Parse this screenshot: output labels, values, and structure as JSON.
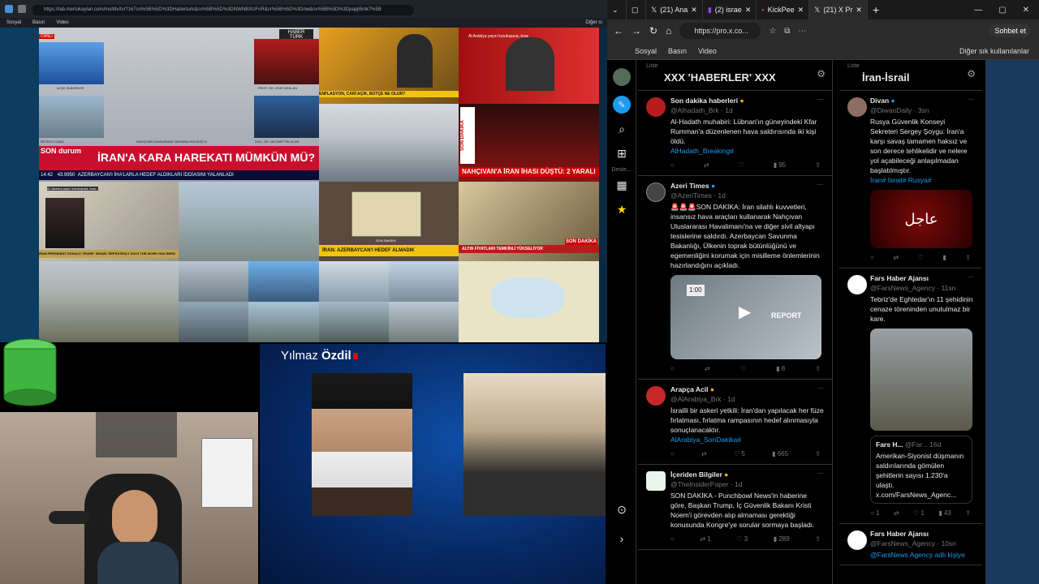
{
  "left_browser": {
    "url": "https://lab.mertokaylan.com/multitv/tv/?167cn%5B%5D%3DHaberturk&cv%5B%5D%3DNWNBSUFnR&cr%5B%5D%3Dnw&nv%5B%5D%3Dpapji5nlk7%5B",
    "bookmarks": [
      "Sosyal",
      "Basın",
      "Video"
    ],
    "other_bookmarks": "Diğer sı",
    "tiles": {
      "canli": "CANLI",
      "haber_logo": "HABER TÜRK",
      "anchor_name": "AYŞE SUBERKER",
      "guest1": "PROF. DR. ERAT ARSLAN",
      "guest2": "DOÇ. DR. NECMETTİN ACAR",
      "beyrut": "BEYRUT-CANLI",
      "nahcivan_small": "NAHÇIVAN HAVALİMANI YAKININA İHA DÜŞTÜ",
      "son_durum": "SON durum",
      "headline": "İRAN'A KARA HAREKATI MÜMKÜN MÜ?",
      "time": "14:42",
      "index": "43.9950",
      "sub": "AZERBAYCAN'I İHA'LARLA HEDEF ALDIKLARI İDDİASINI YALANLADI",
      "son_dakika_tag": "SON DAKİKA",
      "econ": "ENFLASYON, CARİ AÇIK, BÜTÇE NE OLUR?",
      "alarabiya_tag": "Al Arabiya yayın kuruluşuna, kısa",
      "son_dakika_vertical": "SON DAKİKA",
      "nahcivan_big": "NAHÇIVAN'A İRAN İHASI DÜŞTÜ: 2 YARALI",
      "aljazeera": "Al Jazeera yayın kuruluşuna, kısa...",
      "aljazeera_sub": "IRAN PRESIDENT DONALD TRUMP: ISRAEL REPEATEDLY SAYS THE WORK HAS BEEN",
      "iran_azer": "İRAN: AZERBAYCAN'I HEDEF ALMADIK",
      "son_dakika_small": "SON DAKİKA",
      "altin": "ALTIN FİYATLARI TEMKİNLİ YÜKSELİYOR",
      "son_dakika_red": "SON DAKİKA",
      "canli2": "CANLI"
    }
  },
  "video_panel": {
    "name_first": "Yılmaz",
    "name_last": "Özdil"
  },
  "right_browser": {
    "tabs": [
      {
        "label": "(21) Ana",
        "icon": "x-icon"
      },
      {
        "label": "(2) israe",
        "icon": "twitch-icon"
      },
      {
        "label": "KickPee",
        "icon": "kick-icon"
      },
      {
        "label": "(21) X Pr",
        "icon": "x-icon"
      }
    ],
    "url": "https://pro.x.co...",
    "chat_label": "Sohbet et",
    "bookmarks": [
      "Sosyal",
      "Basın",
      "Video"
    ],
    "other_bookmarks": "Diğer sık kullanılanlar"
  },
  "x_nav": {
    "deste_label": "Deste..."
  },
  "column1": {
    "list_label": "Liste",
    "title": "XXX 'HABERLER' XXX",
    "tweets": [
      {
        "name": "Son dakika haberleri",
        "handle": "@Alhadath_Brk",
        "time": "1d",
        "text": "Al-Hadath muhabiri: Lübnan'ın güneyindeki Kfar Rumman'a düzenlenen hava saldırısında iki kişi öldü.",
        "tag": "AlHadath_Breaking#",
        "views": "95",
        "color": "#b71c1c"
      },
      {
        "name": "Azeri Times",
        "handle": "@AzeriTimes",
        "time": "1d",
        "text": "🚨🚨🚨SON DAKİKA: İran silahlı kuvvetleri, insansız hava araçları kullanarak Nahçıvan Uluslararası Havalimanı'na ve diğer sivil altyapı tesislerine saldırdı. Azerbaycan Savunma Bakanlığı, Ülkenin toprak bütünlüğünü ve egemenliğini korumak için misilleme önlemlerinin hazırlandığını açıkladı.",
        "tag": "",
        "views": "8",
        "color": "#333",
        "media_label": "REPORT",
        "media_time": "1:00"
      },
      {
        "name": "Arapça Acil",
        "handle": "@AlArabiya_Brk",
        "time": "1d",
        "text": "İsrailli bir askeri yetkili: İran'dan yapılacak her füze fırlatması, fırlatma rampasının hedef alınmasıyla sonuçlanacaktır.",
        "tag": "AlArabiya_SonDakika#",
        "likes": "5",
        "views": "665",
        "color": "#c62828"
      },
      {
        "name": "İçeriden Bilgiler",
        "handle": "@TheInsiderPaper",
        "time": "1d",
        "text": "SON DAKİKA - Punchbowl News'in haberine göre, Başkan Trump, İç Güvenlik Bakanı Kristi Noem'i görevden alıp almaması gerektiği konusunda Kongre'ye sorular sormaya başladı.",
        "tag": "",
        "retweets": "1",
        "likes": "3",
        "views": "289",
        "color": "#e8f5e9"
      }
    ]
  },
  "column2": {
    "list_label": "Liste",
    "title": "İran-İsrail",
    "tweets": [
      {
        "name": "Divan",
        "handle": "@DiwanDaily",
        "time": "3sn",
        "text": "Rusya Güvenlik Konseyi Sekreteri Sergey Şoygu: İran'a karşı savaş tamamen haksız ve son derece tehlikelidir ve nelere yol açabileceği anlaşılmadan başlatılmıştır.",
        "tag": "İran# İsrail# Rusya#",
        "media_label": "عاجل"
      },
      {
        "name": "Fars Haber Ajansı",
        "handle": "@FarsNews_Agency",
        "time": "11sn",
        "text": "Tebriz'de Eghtedar'ın 11 şehidinin cenaze töreninden unutulmaz bir kare.",
        "quote_name": "Fars H...",
        "quote_handle": "@Far...",
        "quote_time": "16d",
        "quote_text": "Amerikan-Siyonist düşmanın saldırılarında gömülen şehitlerin sayısı 1.230'a ulaştı. x.com/FarsNews_Agenc...",
        "replies": "1",
        "likes": "1",
        "views": "43"
      },
      {
        "name": "Fars Haber Ajansı",
        "handle": "@FarsNews_Agency",
        "time": "10sn",
        "text": "@FarsNews Agency adlı kişiye"
      }
    ]
  }
}
